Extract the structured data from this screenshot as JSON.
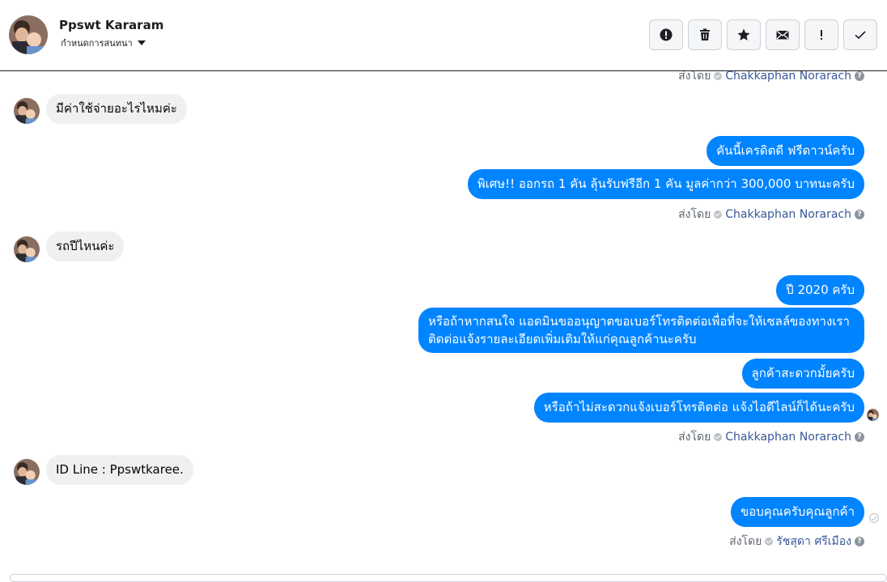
{
  "header": {
    "name": "Ppswt Kararam",
    "subtitle": "กำหนดการสนทนา"
  },
  "toolbar": [
    "report-icon",
    "trash-icon",
    "star-icon",
    "mail-icon",
    "exclamation-icon",
    "check-icon"
  ],
  "messages": {
    "top_meta": {
      "prefix": "ส่งโดย",
      "sender": "Chakkaphan Norarach"
    },
    "in1": "มีค่าใช้จ่ายอะไรไหมค่ะ",
    "out1a": "คันนี้เครดิตดี ฟรีดาวน์ครับ",
    "out1b": "พิเศษ!! ออกรถ 1 คัน ลุ้นรับฟรีอีก 1 คัน มูลค่ากว่า 300,000 บาทนะครับ",
    "meta1": {
      "prefix": "ส่งโดย",
      "sender": "Chakkaphan Norarach"
    },
    "in2": "รถปีไหนค่ะ",
    "out2a": "ปี 2020 ครับ",
    "out2b": "หรือถ้าหากสนใจ แอดมินขออนุญาตขอเบอร์โทรติดต่อเพื่อที่จะให้เซลล์ของทางเราติดต่อแจ้งรายละเอียดเพิ่มเติมให้แก่คุณลูกค้านะครับ",
    "out2c": "ลูกค้าสะดวกมั้ยครับ",
    "out2d": "หรือถ้าไม่สะดวกแจ้งเบอร์โทรติดต่อ แจ้งไอดีไลน์ก็ได้นะครับ",
    "meta2": {
      "prefix": "ส่งโดย",
      "sender": "Chakkaphan Norarach"
    },
    "in3": "ID Line : Ppswtkaree.",
    "out3a": "ขอบคุณครับคุณลูกค้า",
    "meta3": {
      "prefix": "ส่งโดย",
      "sender": "รัชสุดา ศรีเมือง"
    }
  },
  "colors": {
    "sent_bubble": "#0084ff",
    "received_bubble": "#f0f0f0",
    "sender_link": "#385898"
  }
}
